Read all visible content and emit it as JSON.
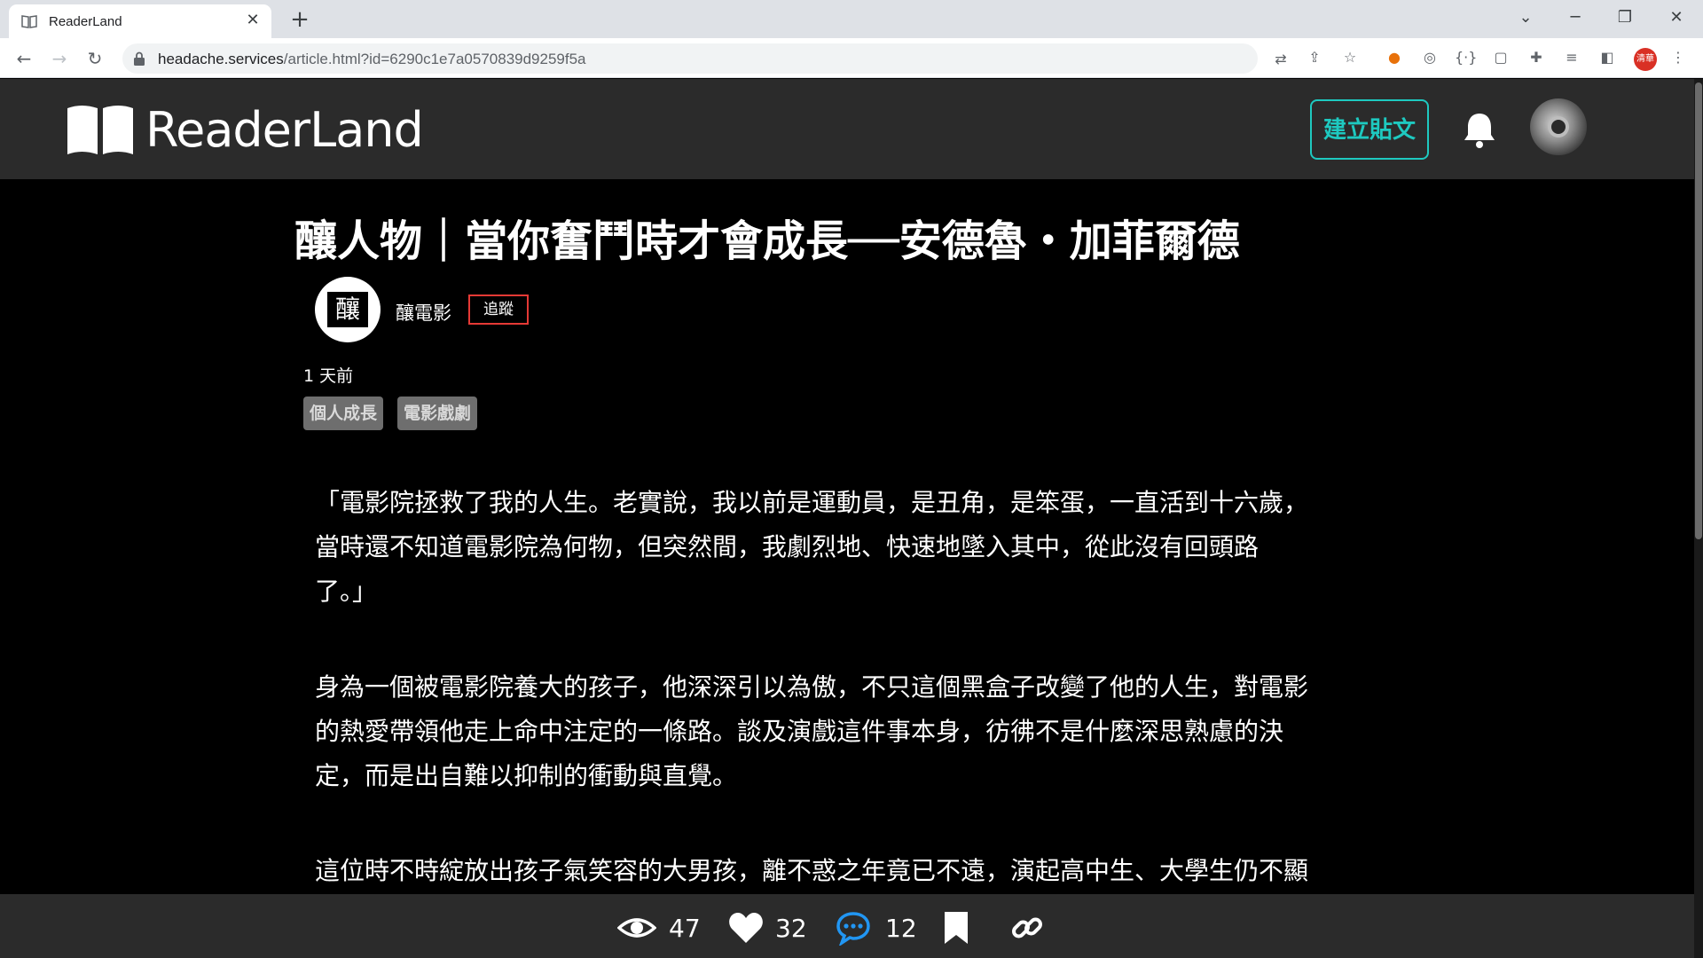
{
  "browser": {
    "tab_title": "ReaderLand",
    "url_host": "headache.services",
    "url_path": "/article.html?id=6290c1e7a0570839d9259f5a",
    "profile_label": "清華"
  },
  "site": {
    "logo_text": "ReaderLand",
    "create_post_label": "建立貼文"
  },
  "article": {
    "title": "釀人物｜當你奮鬥時才會成長──安德魯・加菲爾德",
    "author": {
      "name": "釀電影",
      "avatar_glyph": "釀",
      "follow_label": "追蹤"
    },
    "posted": "1 天前",
    "tags": [
      "個人成長",
      "電影戲劇"
    ],
    "paragraphs": [
      [
        "「電影院拯救了我的人生。老實說，我以前是運動員，是丑角，是笨蛋，一直活到十六歲，",
        "當時還不知道電影院為何物，但突然間，我劇烈地、快速地墜入其中，從此沒有回頭路",
        "了。」"
      ],
      [
        "身為一個被電影院養大的孩子，他深深引以為傲，不只這個黑盒子改變了他的人生，對電影",
        "的熱愛帶領他走上命中注定的一條路。談及演戲這件事本身，彷彿不是什麼深思熟慮的決",
        "定，而是出自難以抑制的衝動與直覺。"
      ],
      [
        "這位時不時綻放出孩子氣笑容的大男孩，離不惑之年竟已不遠，演起高中生、大學生仍不顯"
      ]
    ]
  },
  "actions": {
    "views": "47",
    "likes": "32",
    "comments": "12"
  },
  "colors": {
    "accent": "#1ec9c0",
    "follow_border": "#e53935",
    "header_bg": "#2b2b2b",
    "tag_bg": "#6e6e6e"
  }
}
